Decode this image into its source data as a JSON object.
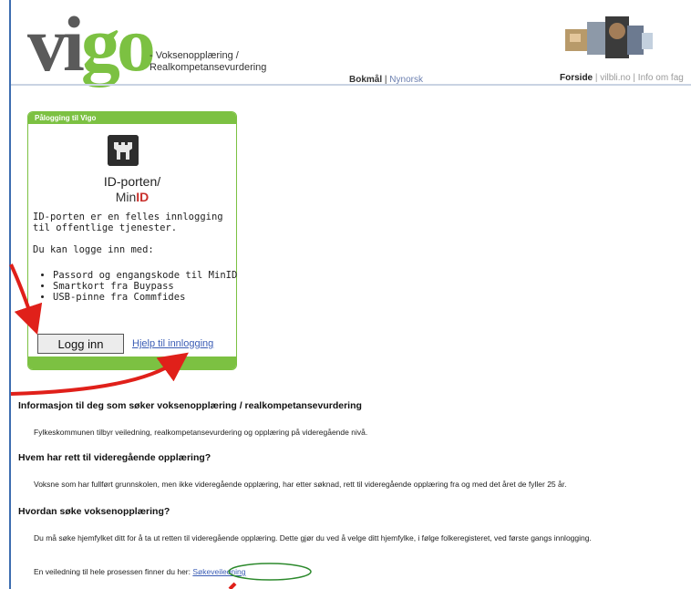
{
  "header": {
    "logo_vi": "vi",
    "logo_go": "go",
    "tagline_line1": "- Voksenopplæring /",
    "tagline_line2": "Realkompetansevurdering",
    "lang_active": "Bokmål",
    "lang_sep": " | ",
    "lang_other": "Nynorsk",
    "nav": {
      "home": "Forside",
      "sep": " | ",
      "link1": "vilbli.no",
      "link2": "Info om fag"
    }
  },
  "login": {
    "header": "Pålogging til Vigo",
    "provider_line1": "ID-porten/",
    "provider_min": "Min",
    "provider_id": "ID",
    "description": "ID-porten er en felles innlogging til offentlige tjenester.",
    "can_login_with": "Du kan logge inn med:",
    "methods": [
      "Passord og engangskode til MinID",
      "Smartkort fra Buypass",
      "USB-pinne fra Commfides"
    ],
    "login_button": "Logg inn",
    "help_link": "Hjelp til innlogging"
  },
  "info": {
    "heading1": "Informasjon til deg som søker voksenopplæring / realkompetansevurdering",
    "text1": "Fylkeskommunen tilbyr veiledning, realkompetansevurdering og opplæring på videregående nivå.",
    "heading2": "Hvem har rett til videregående opplæring?",
    "text2": "Voksne som har fullført grunnskolen, men ikke videregående opplæring, har etter søknad, rett til videregående opplæring fra og med det året de fyller 25 år.",
    "heading3": "Hvordan søke voksenopplæring?",
    "text3": "Du må søke hjemfylket ditt for å ta ut retten til videregående opplæring. Dette gjør du ved å velge ditt hjemfylke, i følge folkeregisteret, ved første gangs innlogging.",
    "text4_prefix": "En veiledning til hele prosessen finner du her:",
    "guide_link": "Søkeveiledning"
  },
  "colors": {
    "accent_green": "#7cc142",
    "annotation_red": "#e0201a",
    "link_blue": "#3b5db5"
  },
  "icons": [
    "idporten-tower-icon",
    "header-photos-image"
  ]
}
